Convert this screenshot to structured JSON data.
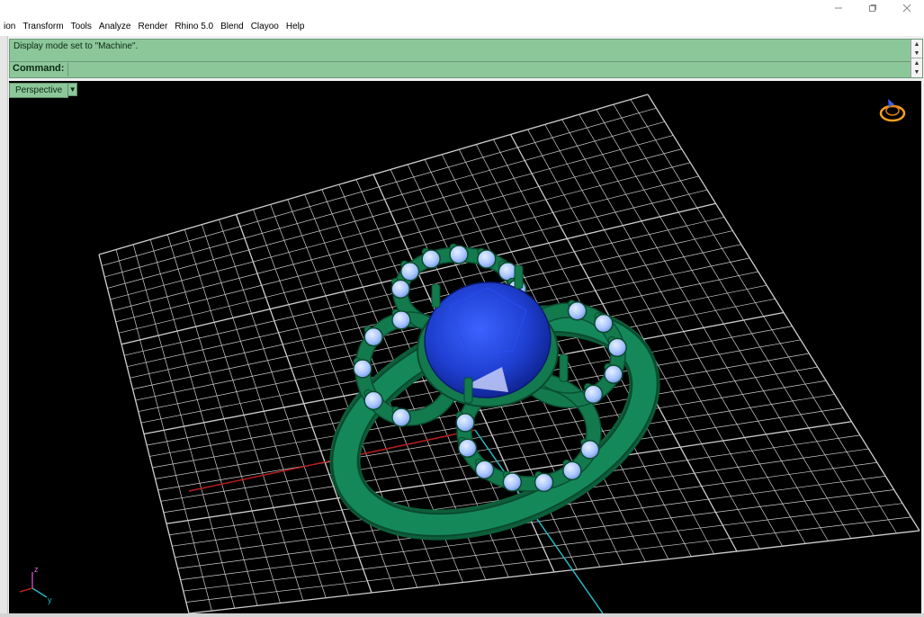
{
  "menu": {
    "items": [
      "ion",
      "Transform",
      "Tools",
      "Analyze",
      "Render",
      "Rhino 5.0",
      "Blend",
      "Clayoo",
      "Help"
    ]
  },
  "window_controls": {
    "minimize_icon": "minimize-icon",
    "restore_icon": "restore-icon",
    "close_icon": "close-icon"
  },
  "command": {
    "history_text": "Display mode set to \"Machine\".",
    "prompt_label": "Command:",
    "input_value": ""
  },
  "viewport": {
    "name": "Perspective",
    "dropdown_icon": "chevron-down-icon",
    "display_mode": "Machine",
    "axes": {
      "x": "x",
      "y": "y",
      "z": "z"
    },
    "colors": {
      "background": "#000000",
      "grid": "#cfcfcf",
      "x_axis": "#b81d1d",
      "y_axis": "#2bb6c0",
      "metal": "#137a4e",
      "center_stone": "#1f3fd1",
      "accent_stones": "#a9c6ff",
      "command_bg": "#8cc79a"
    }
  }
}
